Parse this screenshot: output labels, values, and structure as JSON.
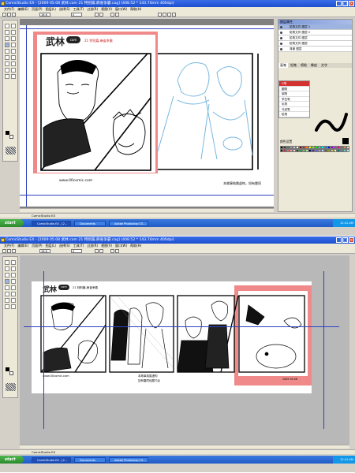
{
  "app": {
    "window_title": "ComicStudio EX - [2009 05.08 武林.com 21 特别篇.麻雀争霸.cag] (408.52 * 143.74mm 400dpi)",
    "menu": [
      "文件(F)",
      "编辑(E)",
      "页面(P)",
      "图层(L)",
      "选择(S)",
      "工具(T)",
      "过滤(R)",
      "视图(V)",
      "窗口(W)",
      "帮助(H)"
    ],
    "zoom": "16.6",
    "rotation": "0",
    "status_text": "ComicStudio EX"
  },
  "top_shot": {
    "layers_panel_title": "图层属性",
    "layers": [
      {
        "name": "铅笔文件",
        "label": "图层 1",
        "active": true
      },
      {
        "name": "铅笔文件",
        "label": "图层 2",
        "active": false
      },
      {
        "name": "铅笔文件",
        "label": "图层",
        "active": false
      },
      {
        "name": "铅笔文件",
        "label": "图层",
        "active": false
      },
      {
        "name": "背景",
        "label": "图层",
        "active": false
      }
    ],
    "tool_tabs": [
      "画笔",
      "铅笔",
      "喷枪",
      "橡皮",
      "文字"
    ],
    "brush_list": [
      "G笔",
      "圆笔",
      "钢笔",
      "学生笔",
      "毛笔",
      "马克笔",
      "铅笔"
    ],
    "brush_selected": "G笔",
    "palette_label": "颜色设置"
  },
  "comic": {
    "site_name": "武林",
    "site_suffix": "com",
    "episode_title": "21 特别篇.麻雀争霸",
    "url": "www.00comic.com",
    "caption_1": "本故事纯属虚构，如有雷同",
    "caption_2": "本故事纯属虚构",
    "caption_3": "如有雷同纯属巧合",
    "credit": "2009 05.08"
  },
  "taskbar": {
    "start_label": "start",
    "items": [
      "ComicStudio EX - [2...",
      "Documents",
      "Adobe Photoshop CS..."
    ],
    "clock": "12:41 AM"
  },
  "colors": {
    "titlebar": "#1c4fcf",
    "highlight_pink": "#f08a8a",
    "blueline": "#7ab8e0",
    "guide_blue": "#2d3fbf"
  }
}
